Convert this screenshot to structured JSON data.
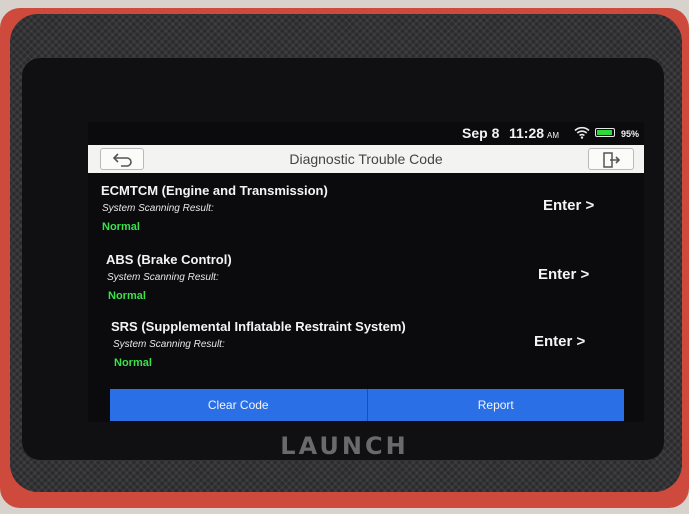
{
  "status_bar": {
    "date": "Sep 8",
    "time": "11:28",
    "ampm": "AM",
    "battery": "95%",
    "battery_color": "#2cd83a",
    "wifi_icon": "wifi-icon",
    "battery_icon": "battery-icon"
  },
  "header": {
    "title": "Diagnostic Trouble Code",
    "back_icon": "back-arrow-icon",
    "exit_icon": "exit-icon"
  },
  "systems": [
    {
      "name": "ECMTCM (Engine and Transmission)",
      "scan_label": "System Scanning Result:",
      "result": "Normal",
      "enter_label": "Enter >"
    },
    {
      "name": "ABS (Brake Control)",
      "scan_label": "System Scanning Result:",
      "result": "Normal",
      "enter_label": "Enter >"
    },
    {
      "name": "SRS (Supplemental Inflatable Restraint System)",
      "scan_label": "System Scanning Result:",
      "result": "Normal",
      "enter_label": "Enter >"
    }
  ],
  "footer": {
    "clear_code_label": "Clear Code",
    "report_label": "Report",
    "accent_color": "#2a6fe6"
  },
  "device": {
    "brand": "LAUNCH",
    "frame_color": "#ce4a3c"
  }
}
